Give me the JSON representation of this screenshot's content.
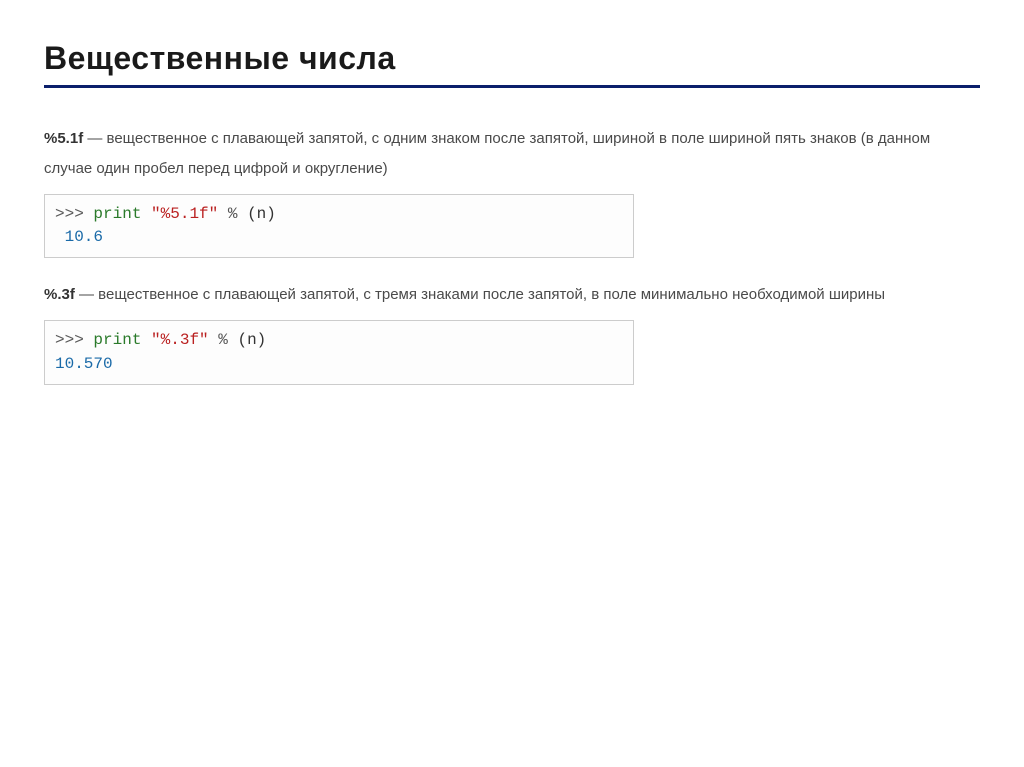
{
  "title": "Вещественные числа",
  "section1": {
    "fmt": "%5.1f",
    "desc": " — вещественное с плавающей запятой, с одним знаком после запятой, шириной в поле шириной пять знаков (в данном случае один пробел перед цифрой и округление)",
    "code": {
      "prompt": ">>> ",
      "print": "print",
      "space1": " ",
      "str": "\"%5.1f\"",
      "space2": " ",
      "op": "%",
      "space3": " ",
      "args": "(n)",
      "output": " 10.6"
    }
  },
  "section2": {
    "fmt": "%.3f",
    "desc": " — вещественное с плавающей запятой, с тремя знаками после запятой, в поле минимально необходимой ширины",
    "code": {
      "prompt": ">>> ",
      "print": "print",
      "space1": " ",
      "str": "\"%.3f\"",
      "space2": " ",
      "op": "%",
      "space3": " ",
      "args": "(n)",
      "output": "10.570"
    }
  }
}
